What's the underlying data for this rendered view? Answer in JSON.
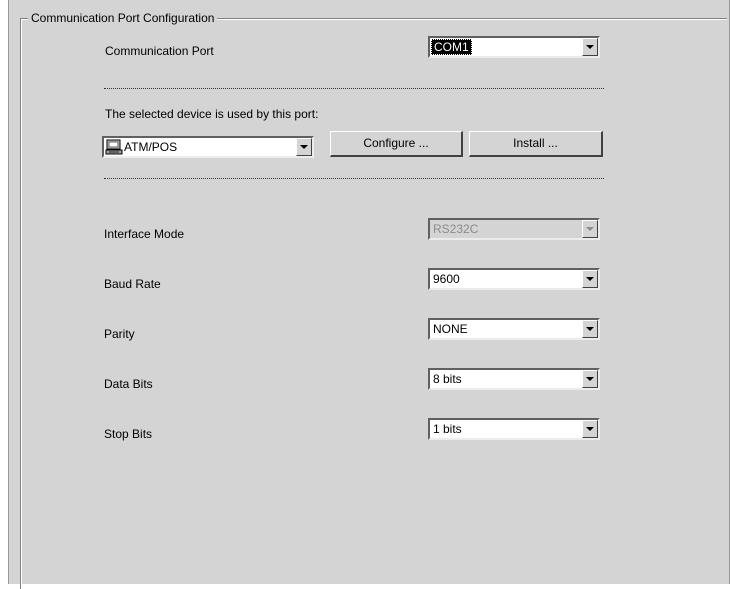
{
  "group": {
    "title": "Communication Port Configuration"
  },
  "comm_port": {
    "label": "Communication Port",
    "value": "COM1"
  },
  "device": {
    "caption": "The selected device is used by this port:",
    "value": "ATM/POS",
    "icon": "atm-pos-device-icon"
  },
  "buttons": {
    "configure": "Configure ...",
    "install": "Install ..."
  },
  "settings": {
    "interface_mode": {
      "label": "Interface Mode",
      "value": "RS232C",
      "enabled": false
    },
    "baud_rate": {
      "label": "Baud Rate",
      "value": "9600"
    },
    "parity": {
      "label": "Parity",
      "value": "NONE"
    },
    "data_bits": {
      "label": "Data Bits",
      "value": "8 bits"
    },
    "stop_bits": {
      "label": "Stop Bits",
      "value": "1 bits"
    }
  },
  "colors": {
    "panel_bg": "#d4d4d4",
    "field_bg": "#ffffff",
    "selection_bg": "#000000"
  }
}
